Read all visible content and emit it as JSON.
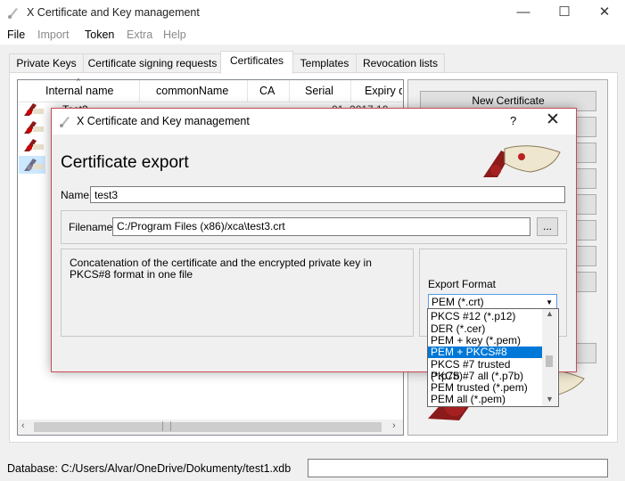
{
  "app": {
    "title": "X Certificate and Key management"
  },
  "window_controls": {
    "minimize": "—",
    "maximize": "☐",
    "close": "✕"
  },
  "menu": [
    "File",
    "Import",
    "Token",
    "Extra",
    "Help"
  ],
  "tabs": [
    "Private Keys",
    "Certificate signing requests",
    "Certificates",
    "Templates",
    "Revocation lists"
  ],
  "active_tab": "Certificates",
  "list": {
    "columns": [
      "Internal name",
      "commonName",
      "CA",
      "Serial",
      "Expiry d"
    ],
    "partial_row_name": "Test2",
    "partial_row_expiry": "01. 2017 10"
  },
  "side_buttons": {
    "new_certificate": "New Certificate"
  },
  "status": {
    "database": "Database: C:/Users/Alvar/OneDrive/Dokumenty/test1.xdb"
  },
  "dialog": {
    "title": "X Certificate and Key management",
    "help": "?",
    "close": "✕",
    "heading": "Certificate export",
    "name_label": "Name",
    "name_value": "test3",
    "filename_label": "Filename",
    "filename_value": "C:/Program Files (x86)/xca\\test3.crt",
    "browse_label": "...",
    "description": "Concatenation of the certificate and the encrypted private key in PKCS#8 format in one file",
    "export_format_label": "Export Format",
    "export_format_value": "PEM (*.crt)",
    "format_options": [
      "PKCS #12 (*.p12)",
      "DER (*.cer)",
      "PEM + key (*.pem)",
      "PEM + PKCS#8 (*.pem)",
      "PKCS #7 trusted (*.p7b)",
      "PKCS #7 all (*.p7b)",
      "PEM trusted (*.pem)",
      "PEM all (*.pem)"
    ],
    "selected_option": "PEM + PKCS#8 (*.pem)"
  },
  "colors": {
    "selection": "#0078d7",
    "dialog_border": "#c94b55",
    "logo_red": "#8b1a1a"
  }
}
